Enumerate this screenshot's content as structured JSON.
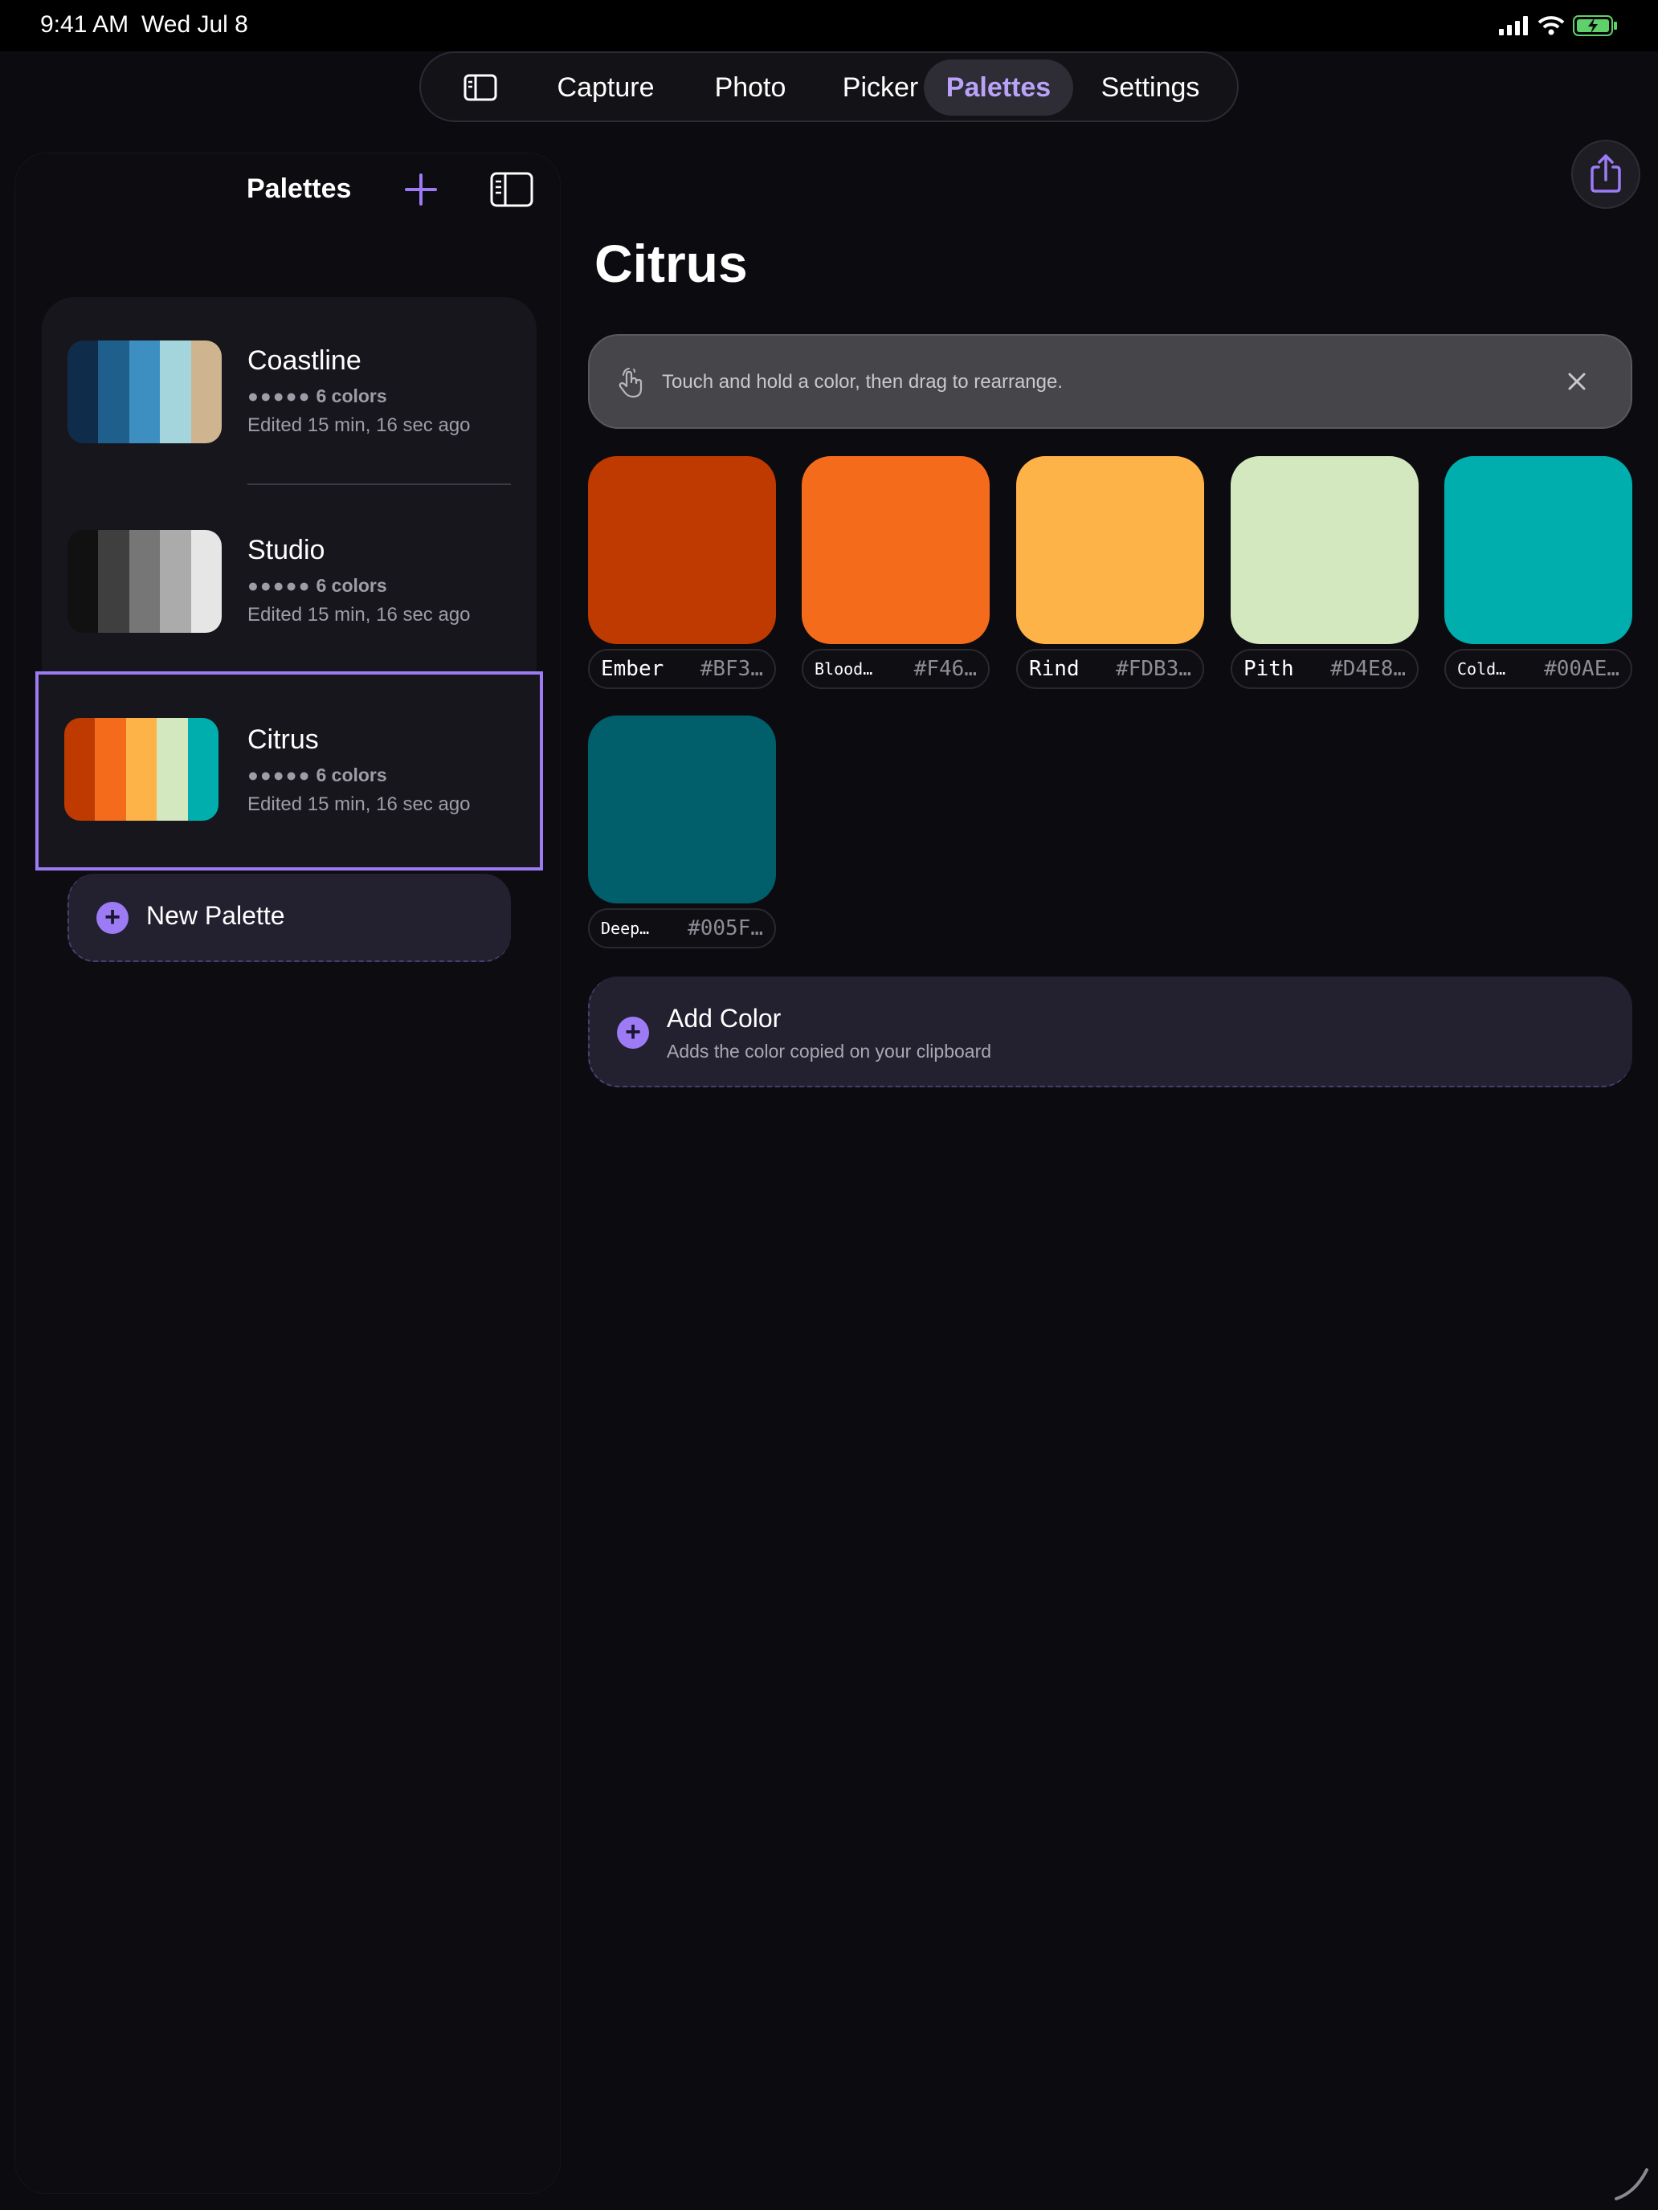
{
  "status": {
    "time": "9:41 AM",
    "date": "Wed Jul 8"
  },
  "tabs": [
    {
      "label": "Capture"
    },
    {
      "label": "Photo"
    },
    {
      "label": "Picker"
    },
    {
      "label": "Palettes",
      "selected": true
    },
    {
      "label": "Settings"
    }
  ],
  "sidebar": {
    "title": "Palettes",
    "palettes": [
      {
        "name": "Coastline",
        "dots": "●●●●●",
        "count": "6 colors",
        "edited": "Edited 15 min, 16 sec ago",
        "colors": [
          "#0f2d4a",
          "#1e5f8c",
          "#3d8fc2",
          "#a4d4dc",
          "#cfb58f"
        ]
      },
      {
        "name": "Studio",
        "dots": "●●●●●",
        "count": "6 colors",
        "edited": "Edited 15 min, 16 sec ago",
        "colors": [
          "#111111",
          "#3f3f3f",
          "#767676",
          "#ababab",
          "#e6e6e6"
        ]
      },
      {
        "name": "Citrus",
        "dots": "●●●●●",
        "count": "6 colors",
        "edited": "Edited 15 min, 16 sec ago",
        "colors": [
          "#BF3A00",
          "#F46B1C",
          "#FDB347",
          "#D4E8C0",
          "#00AEAE"
        ],
        "selected": true
      }
    ],
    "new_palette_label": "New Palette"
  },
  "main": {
    "title": "Citrus",
    "hint": "Touch and hold a color, then drag to rearrange.",
    "swatches": [
      {
        "name": "Ember",
        "hex": "#BF3…",
        "color": "#BF3A00"
      },
      {
        "name": "Blood…",
        "hex": "#F46…",
        "color": "#F46B1C"
      },
      {
        "name": "Rind",
        "hex": "#FDB3…",
        "color": "#FDB347"
      },
      {
        "name": "Pith",
        "hex": "#D4E8…",
        "color": "#D4E8C0"
      },
      {
        "name": "Cold…",
        "hex": "#00AE…",
        "color": "#00AEAE"
      },
      {
        "name": "Deep…",
        "hex": "#005F…",
        "color": "#005F6B"
      }
    ],
    "add_color": {
      "title": "Add Color",
      "subtitle": "Adds the color copied on your clipboard"
    }
  },
  "accent": "#9C7BF5"
}
